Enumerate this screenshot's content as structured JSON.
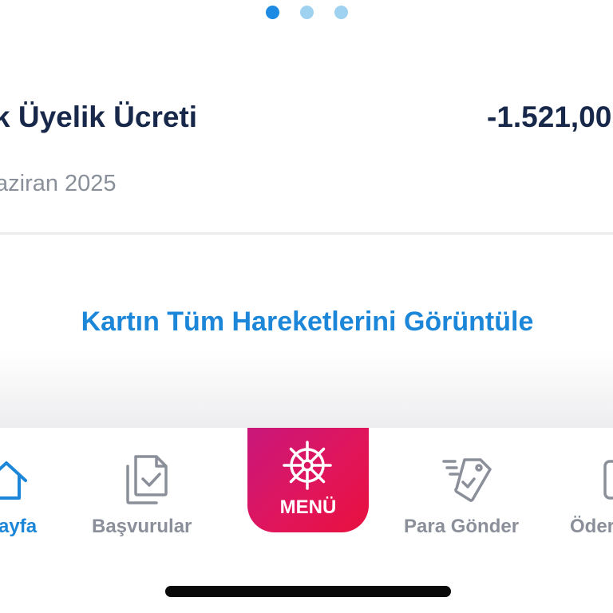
{
  "pager": {
    "pages": 3,
    "active_index": 0
  },
  "transaction": {
    "title": "k Üyelik Ücreti",
    "amount": "-1.521,00",
    "date": "aziran 2025"
  },
  "view_all_link": "Kartın Tüm Hareketlerini Görüntüle",
  "bottom_nav": {
    "items": [
      {
        "label": "ayfa",
        "icon": "home-icon",
        "active": true
      },
      {
        "label": "Başvurular",
        "icon": "documents-check-icon",
        "active": false
      },
      {
        "label": "MENÜ",
        "icon": "ship-wheel-icon",
        "active": false
      },
      {
        "label": "Para Gönder",
        "icon": "send-money-tag-icon",
        "active": false
      },
      {
        "label": "Öder",
        "icon": "payment-icon",
        "active": false
      }
    ]
  },
  "colors": {
    "accent_blue": "#1c86d8",
    "title_navy": "#17284a",
    "menu_magenta": "#e0155b",
    "inactive_gray": "#8a8f99"
  }
}
